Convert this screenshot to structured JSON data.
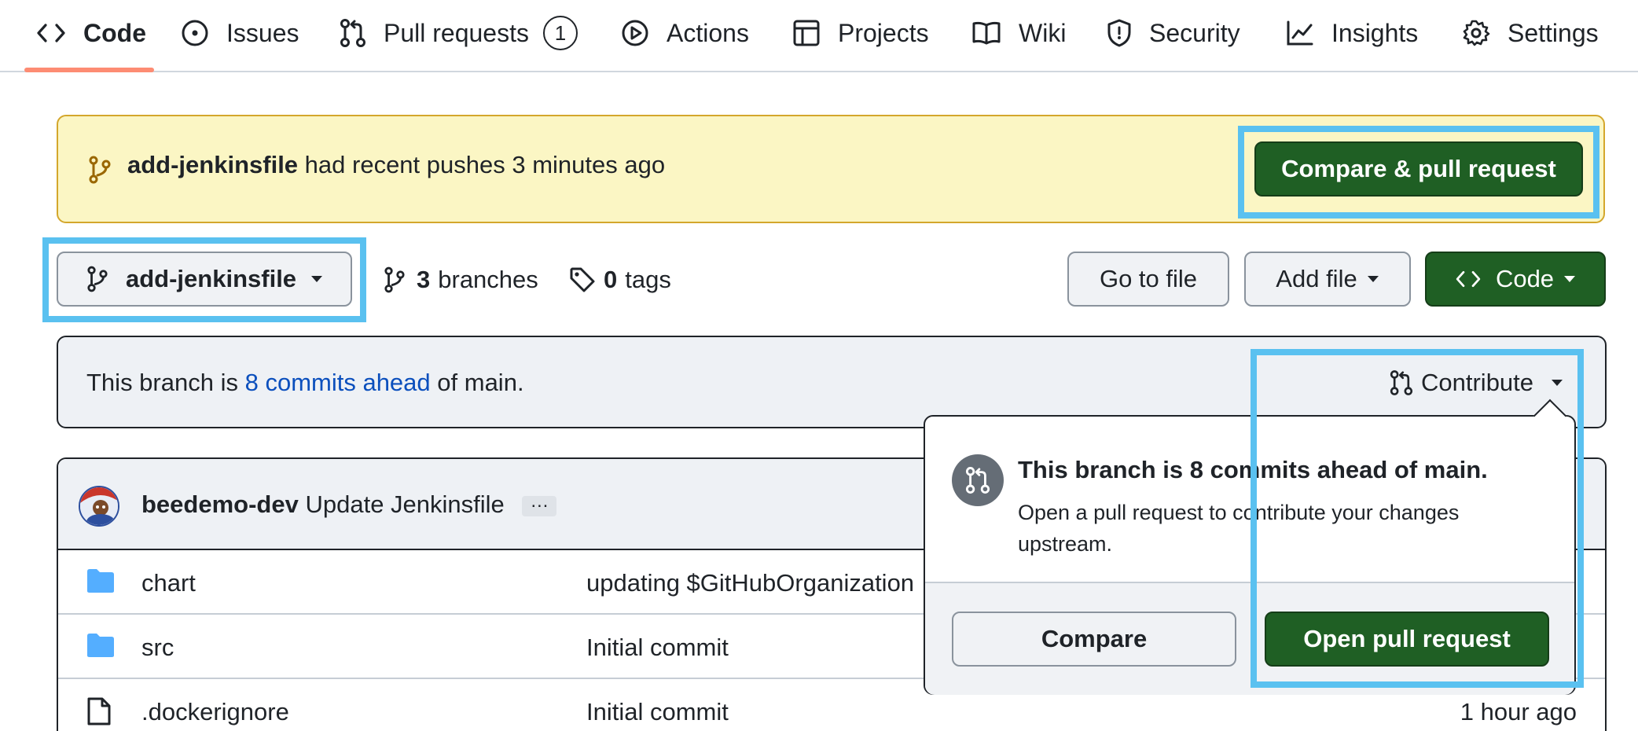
{
  "nav": {
    "code": "Code",
    "issues": "Issues",
    "pulls": "Pull requests",
    "pulls_count": "1",
    "actions": "Actions",
    "projects": "Projects",
    "wiki": "Wiki",
    "security": "Security",
    "insights": "Insights",
    "settings": "Settings"
  },
  "banner": {
    "branch": "add-jenkinsfile",
    "text": "had recent pushes 3 minutes ago",
    "button": "Compare & pull request"
  },
  "branch_bar": {
    "selected_branch": "add-jenkinsfile",
    "branches_count": "3",
    "branches_label": "branches",
    "tags_count": "0",
    "tags_label": "tags",
    "go_to_file": "Go to file",
    "add_file": "Add file",
    "code": "Code"
  },
  "ahead": {
    "prefix": "This branch is",
    "link": "8 commits ahead",
    "suffix": "of main.",
    "contribute": "Contribute"
  },
  "commit": {
    "author": "beedemo-dev",
    "message": "Update Jenkinsfile",
    "ellipsis": "…"
  },
  "files": [
    {
      "type": "folder",
      "name": "chart",
      "message": "updating $GitHubOrganization",
      "time": ""
    },
    {
      "type": "folder",
      "name": "src",
      "message": "Initial commit",
      "time": ""
    },
    {
      "type": "file",
      "name": ".dockerignore",
      "message": "Initial commit",
      "time": "1 hour ago"
    }
  ],
  "popover": {
    "title": "This branch is 8 commits ahead of main.",
    "description": "Open a pull request to contribute your changes upstream.",
    "compare": "Compare",
    "open_pr": "Open pull request"
  },
  "colors": {
    "accent_green": "#1f5f24",
    "highlight": "#5ac1f0",
    "banner_bg": "#fbf6c4",
    "link": "#0b4fbd",
    "folder": "#54aeff"
  }
}
